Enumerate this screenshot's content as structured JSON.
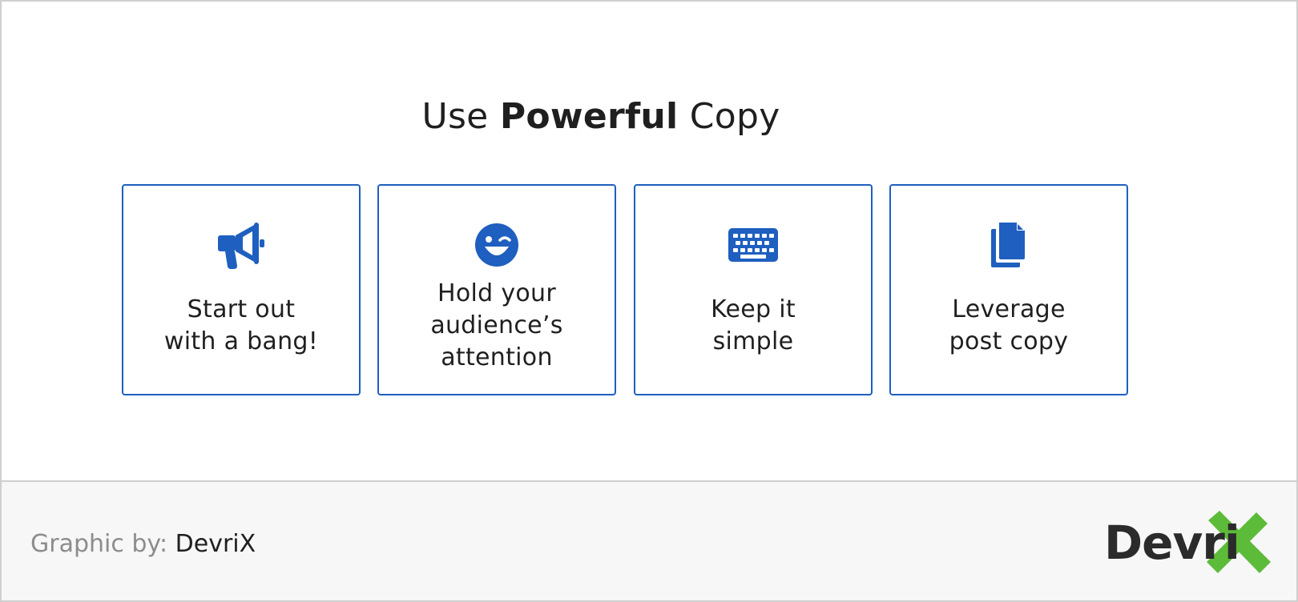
{
  "title": {
    "prefix": "Use ",
    "emphasis": "Powerful",
    "suffix": " Copy"
  },
  "cards": [
    {
      "icon": "megaphone-icon",
      "label": "Start out\nwith a bang!"
    },
    {
      "icon": "winking-face-icon",
      "label": "Hold your\naudience’s\nattention"
    },
    {
      "icon": "keyboard-icon",
      "label": "Keep it\nsimple"
    },
    {
      "icon": "copy-documents-icon",
      "label": "Leverage\npost copy"
    }
  ],
  "footer": {
    "credit_label": "Graphic by: ",
    "credit_value": "DevriX",
    "logo_text": "Devri"
  },
  "colors": {
    "accent": "#1e5fbf",
    "logo_x": "#5dbb3a",
    "text": "#1f1f1f"
  }
}
